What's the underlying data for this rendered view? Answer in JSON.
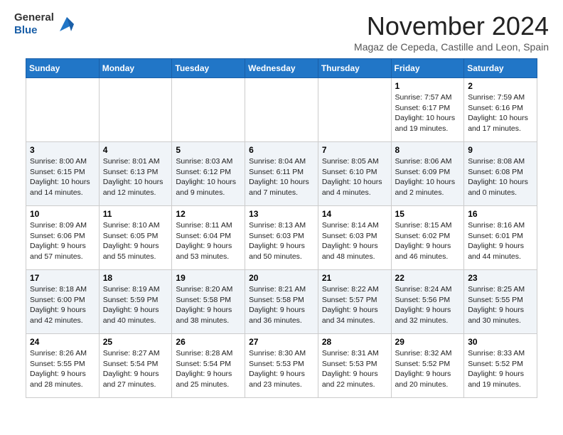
{
  "header": {
    "logo_line1": "General",
    "logo_line2": "Blue",
    "month": "November 2024",
    "location": "Magaz de Cepeda, Castille and Leon, Spain"
  },
  "weekdays": [
    "Sunday",
    "Monday",
    "Tuesday",
    "Wednesday",
    "Thursday",
    "Friday",
    "Saturday"
  ],
  "weeks": [
    [
      {
        "day": "",
        "info": ""
      },
      {
        "day": "",
        "info": ""
      },
      {
        "day": "",
        "info": ""
      },
      {
        "day": "",
        "info": ""
      },
      {
        "day": "",
        "info": ""
      },
      {
        "day": "1",
        "info": "Sunrise: 7:57 AM\nSunset: 6:17 PM\nDaylight: 10 hours\nand 19 minutes."
      },
      {
        "day": "2",
        "info": "Sunrise: 7:59 AM\nSunset: 6:16 PM\nDaylight: 10 hours\nand 17 minutes."
      }
    ],
    [
      {
        "day": "3",
        "info": "Sunrise: 8:00 AM\nSunset: 6:15 PM\nDaylight: 10 hours\nand 14 minutes."
      },
      {
        "day": "4",
        "info": "Sunrise: 8:01 AM\nSunset: 6:13 PM\nDaylight: 10 hours\nand 12 minutes."
      },
      {
        "day": "5",
        "info": "Sunrise: 8:03 AM\nSunset: 6:12 PM\nDaylight: 10 hours\nand 9 minutes."
      },
      {
        "day": "6",
        "info": "Sunrise: 8:04 AM\nSunset: 6:11 PM\nDaylight: 10 hours\nand 7 minutes."
      },
      {
        "day": "7",
        "info": "Sunrise: 8:05 AM\nSunset: 6:10 PM\nDaylight: 10 hours\nand 4 minutes."
      },
      {
        "day": "8",
        "info": "Sunrise: 8:06 AM\nSunset: 6:09 PM\nDaylight: 10 hours\nand 2 minutes."
      },
      {
        "day": "9",
        "info": "Sunrise: 8:08 AM\nSunset: 6:08 PM\nDaylight: 10 hours\nand 0 minutes."
      }
    ],
    [
      {
        "day": "10",
        "info": "Sunrise: 8:09 AM\nSunset: 6:06 PM\nDaylight: 9 hours\nand 57 minutes."
      },
      {
        "day": "11",
        "info": "Sunrise: 8:10 AM\nSunset: 6:05 PM\nDaylight: 9 hours\nand 55 minutes."
      },
      {
        "day": "12",
        "info": "Sunrise: 8:11 AM\nSunset: 6:04 PM\nDaylight: 9 hours\nand 53 minutes."
      },
      {
        "day": "13",
        "info": "Sunrise: 8:13 AM\nSunset: 6:03 PM\nDaylight: 9 hours\nand 50 minutes."
      },
      {
        "day": "14",
        "info": "Sunrise: 8:14 AM\nSunset: 6:03 PM\nDaylight: 9 hours\nand 48 minutes."
      },
      {
        "day": "15",
        "info": "Sunrise: 8:15 AM\nSunset: 6:02 PM\nDaylight: 9 hours\nand 46 minutes."
      },
      {
        "day": "16",
        "info": "Sunrise: 8:16 AM\nSunset: 6:01 PM\nDaylight: 9 hours\nand 44 minutes."
      }
    ],
    [
      {
        "day": "17",
        "info": "Sunrise: 8:18 AM\nSunset: 6:00 PM\nDaylight: 9 hours\nand 42 minutes."
      },
      {
        "day": "18",
        "info": "Sunrise: 8:19 AM\nSunset: 5:59 PM\nDaylight: 9 hours\nand 40 minutes."
      },
      {
        "day": "19",
        "info": "Sunrise: 8:20 AM\nSunset: 5:58 PM\nDaylight: 9 hours\nand 38 minutes."
      },
      {
        "day": "20",
        "info": "Sunrise: 8:21 AM\nSunset: 5:58 PM\nDaylight: 9 hours\nand 36 minutes."
      },
      {
        "day": "21",
        "info": "Sunrise: 8:22 AM\nSunset: 5:57 PM\nDaylight: 9 hours\nand 34 minutes."
      },
      {
        "day": "22",
        "info": "Sunrise: 8:24 AM\nSunset: 5:56 PM\nDaylight: 9 hours\nand 32 minutes."
      },
      {
        "day": "23",
        "info": "Sunrise: 8:25 AM\nSunset: 5:55 PM\nDaylight: 9 hours\nand 30 minutes."
      }
    ],
    [
      {
        "day": "24",
        "info": "Sunrise: 8:26 AM\nSunset: 5:55 PM\nDaylight: 9 hours\nand 28 minutes."
      },
      {
        "day": "25",
        "info": "Sunrise: 8:27 AM\nSunset: 5:54 PM\nDaylight: 9 hours\nand 27 minutes."
      },
      {
        "day": "26",
        "info": "Sunrise: 8:28 AM\nSunset: 5:54 PM\nDaylight: 9 hours\nand 25 minutes."
      },
      {
        "day": "27",
        "info": "Sunrise: 8:30 AM\nSunset: 5:53 PM\nDaylight: 9 hours\nand 23 minutes."
      },
      {
        "day": "28",
        "info": "Sunrise: 8:31 AM\nSunset: 5:53 PM\nDaylight: 9 hours\nand 22 minutes."
      },
      {
        "day": "29",
        "info": "Sunrise: 8:32 AM\nSunset: 5:52 PM\nDaylight: 9 hours\nand 20 minutes."
      },
      {
        "day": "30",
        "info": "Sunrise: 8:33 AM\nSunset: 5:52 PM\nDaylight: 9 hours\nand 19 minutes."
      }
    ]
  ]
}
